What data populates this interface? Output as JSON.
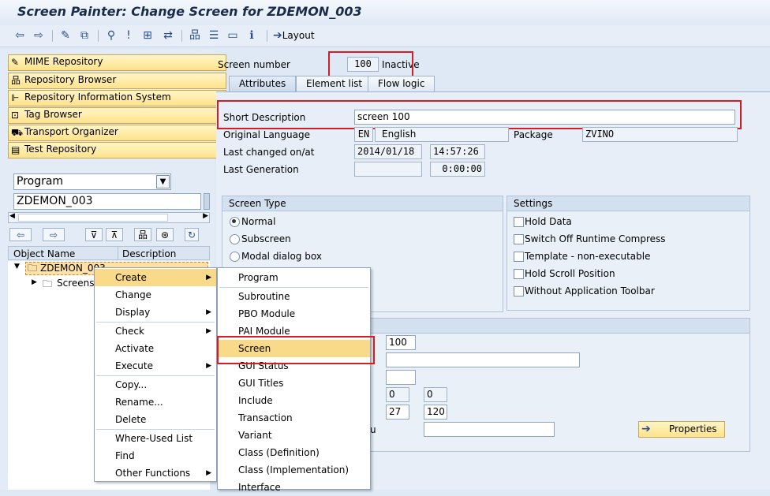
{
  "window": {
    "title": "Screen Painter: Change Screen for ZDEMON_003"
  },
  "toolbar": {
    "layout_label": "Layout"
  },
  "left_nav": {
    "items": [
      {
        "label": "MIME Repository"
      },
      {
        "label": "Repository Browser"
      },
      {
        "label": "Repository Information System"
      },
      {
        "label": "Tag Browser"
      },
      {
        "label": "Transport Organizer"
      },
      {
        "label": "Test Repository"
      }
    ],
    "object_type": "Program",
    "object_name": "ZDEMON_003",
    "tree_headers": {
      "name": "Object Name",
      "description": "Description"
    },
    "tree": {
      "root": "ZDEMON_003",
      "child": "Screens"
    }
  },
  "screen": {
    "number_label": "Screen number",
    "number": "100",
    "status": "Inactive",
    "tabs": [
      {
        "label": "Attributes"
      },
      {
        "label": "Element list"
      },
      {
        "label": "Flow logic"
      }
    ],
    "short_desc_label": "Short Description",
    "short_desc": "screen 100",
    "orig_lang_label": "Original Language",
    "lang_code": "EN",
    "lang_name": "English",
    "package_label": "Package",
    "package": "ZVINO",
    "last_changed_label": "Last changed on/at",
    "last_changed_date": "2014/01/18",
    "last_changed_time": "14:57:26",
    "last_gen_label": "Last Generation",
    "last_gen_time": "0:00:00"
  },
  "screen_type": {
    "title": "Screen Type",
    "options": [
      {
        "label": "Normal"
      },
      {
        "label": "Subscreen"
      },
      {
        "label": "Modal dialog box"
      }
    ]
  },
  "settings": {
    "title": "Settings",
    "options": [
      {
        "label": "Hold Data"
      },
      {
        "label": "Switch Off Runtime Compress"
      },
      {
        "label": "Template - non-executable"
      },
      {
        "label": "Hold Scroll Position"
      },
      {
        "label": "Without Application Toolbar"
      }
    ]
  },
  "other_attrs": {
    "next_screen": "100",
    "v1": "0",
    "v2": "0",
    "v3": "27",
    "v4": "120",
    "partial_label": "u",
    "properties_label": "Properties"
  },
  "context_menu": {
    "items": [
      {
        "label": "Create"
      },
      {
        "label": "Change"
      },
      {
        "label": "Display"
      },
      {
        "label": "Check"
      },
      {
        "label": "Activate"
      },
      {
        "label": "Execute"
      },
      {
        "label": "Copy..."
      },
      {
        "label": "Rename..."
      },
      {
        "label": "Delete"
      },
      {
        "label": "Where-Used List"
      },
      {
        "label": "Find"
      },
      {
        "label": "Other Functions"
      }
    ]
  },
  "create_submenu": {
    "items": [
      {
        "label": "Program"
      },
      {
        "label": "Subroutine"
      },
      {
        "label": "PBO Module"
      },
      {
        "label": "PAI Module"
      },
      {
        "label": "Screen"
      },
      {
        "label": "GUI Status"
      },
      {
        "label": "GUI Titles"
      },
      {
        "label": "Include"
      },
      {
        "label": "Transaction"
      },
      {
        "label": "Variant"
      },
      {
        "label": "Class (Definition)"
      },
      {
        "label": "Class (Implementation)"
      },
      {
        "label": "Interface"
      }
    ]
  },
  "colors": {
    "highlight": "#d71d24",
    "accent": "#2a4e86",
    "nav_button": "#ffe38a"
  }
}
